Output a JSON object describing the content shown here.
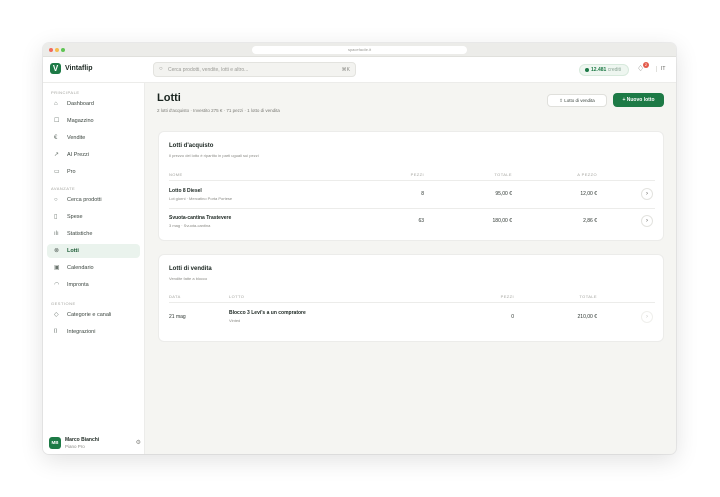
{
  "browser": {
    "url": "spacefacile.it"
  },
  "app": {
    "name": "Vintaflip",
    "logo_letter": "V"
  },
  "search": {
    "placeholder": "Cerca prodotti, vendite, lotti e altro...",
    "shortcut": "⌘K"
  },
  "balance": {
    "value": "12.481",
    "unit": "crediti"
  },
  "notifications": {
    "count": "2"
  },
  "language": "IT",
  "sidebar": {
    "section_main": "PRINCIPALE",
    "main_items": [
      {
        "label": "Dashboard"
      },
      {
        "label": "Magazzino"
      },
      {
        "label": "Vendite"
      },
      {
        "label": "AI Prezzi"
      },
      {
        "label": "Pro"
      }
    ],
    "section_advanced": "AVANZATE",
    "advanced_items": [
      {
        "label": "Cerca prodotti"
      },
      {
        "label": "Spese"
      },
      {
        "label": "Statistiche"
      },
      {
        "label": "Lotti"
      },
      {
        "label": "Calendario"
      },
      {
        "label": "Impronta"
      }
    ],
    "section_manage": "GESTIONE",
    "manage_items": [
      {
        "label": "Categorie e canali"
      },
      {
        "label": "Integrazioni"
      }
    ],
    "user": {
      "initials": "MB",
      "name": "Marco Bianchi",
      "plan": "Piano Pro"
    }
  },
  "page": {
    "title": "Lotti",
    "subtitle": "2 lotti d'acquisto · Investito 275 € · 71 pezzi · 1 lotto di vendita",
    "btn_sale_lot": "Lotto di vendita",
    "btn_new_lot": "Nuovo lotto"
  },
  "purchase": {
    "title": "Lotti d'acquisto",
    "subtitle": "Il prezzo del lotto è ripartito in parti uguali sui pezzi",
    "headers": {
      "name": "NOME",
      "pieces": "PEZZI",
      "total": "TOTALE",
      "per_piece": "A PEZZO"
    },
    "rows": [
      {
        "name": "Lotto 8 Diesel",
        "meta": "Lot giorni · Mercatino Porta Portese",
        "pieces": "8",
        "total": "95,00 €",
        "per_piece": "12,00 €"
      },
      {
        "name": "Svuota-cantina Trastevere",
        "meta": "3 mag · Svuota-cantina",
        "pieces": "63",
        "total": "180,00 €",
        "per_piece": "2,86 €"
      }
    ]
  },
  "sale": {
    "title": "Lotti di vendita",
    "subtitle": "Vendite fatte a blocco",
    "headers": {
      "date": "DATA",
      "lot": "LOTTO",
      "pieces": "PEZZI",
      "total": "TOTALE"
    },
    "rows": [
      {
        "date": "21 mag",
        "lot": "Blocco 3 Levi's a un compratore",
        "meta": "Vinted",
        "pieces": "0",
        "total": "210,00 €"
      }
    ]
  }
}
